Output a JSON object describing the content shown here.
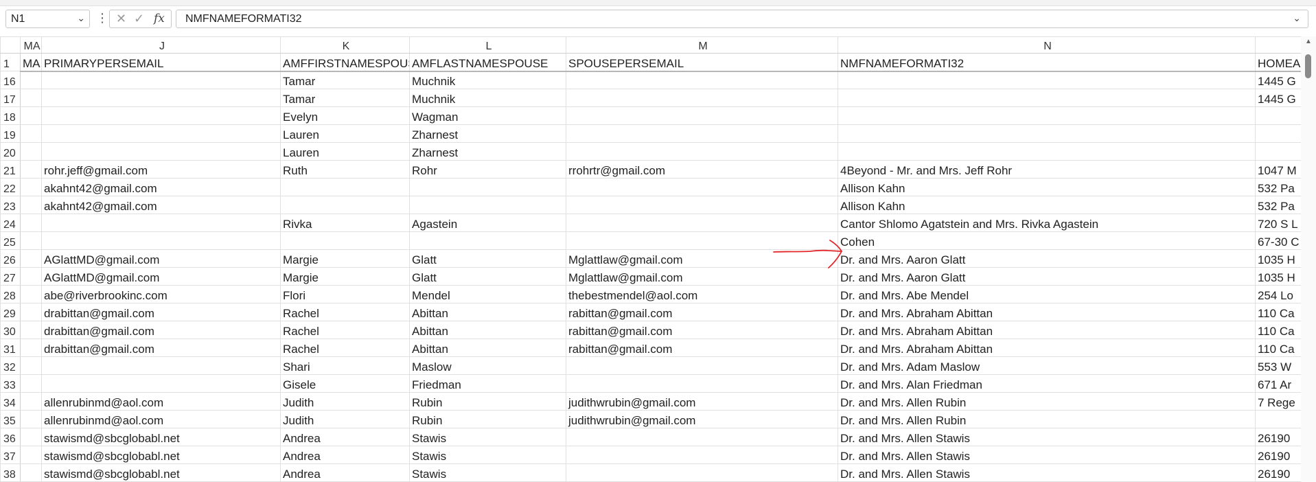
{
  "formula_bar": {
    "name_box": "N1",
    "formula": "NMFNAMEFORMATI32",
    "fx_label": "fx"
  },
  "columns": [
    "MA",
    "J",
    "K",
    "L",
    "M",
    "N",
    ""
  ],
  "header_row": {
    "row": "1",
    "cells": [
      "MA",
      "PRIMARYPERSEMAIL",
      "AMFFIRSTNAMESPOUSE",
      "AMFLASTNAMESPOUSE",
      "SPOUSEPERSEMAIL",
      "NMFNAMEFORMATI32",
      "HOMEADDRESS"
    ]
  },
  "rows": [
    {
      "row": "16",
      "cells": [
        "",
        "",
        "Tamar",
        "Muchnik",
        "",
        "",
        "1445 G"
      ]
    },
    {
      "row": "17",
      "cells": [
        "",
        "",
        "Tamar",
        "Muchnik",
        "",
        "",
        "1445 G"
      ]
    },
    {
      "row": "18",
      "cells": [
        "",
        "",
        "Evelyn",
        "Wagman",
        "",
        "",
        ""
      ]
    },
    {
      "row": "19",
      "cells": [
        "",
        "",
        "Lauren",
        "Zharnest",
        "",
        "",
        ""
      ]
    },
    {
      "row": "20",
      "cells": [
        "",
        "",
        "Lauren",
        "Zharnest",
        "",
        "",
        ""
      ]
    },
    {
      "row": "21",
      "cells": [
        "",
        "rohr.jeff@gmail.com",
        "Ruth",
        "Rohr",
        "rrohrtr@gmail.com",
        "4Beyond - Mr. and Mrs. Jeff Rohr",
        "1047 M"
      ]
    },
    {
      "row": "22",
      "cells": [
        "",
        "akahnt42@gmail.com",
        "",
        "",
        "",
        "Allison Kahn",
        "532 Pa"
      ]
    },
    {
      "row": "23",
      "cells": [
        "",
        "akahnt42@gmail.com",
        "",
        "",
        "",
        "Allison Kahn",
        "532 Pa"
      ]
    },
    {
      "row": "24",
      "cells": [
        "",
        "",
        "Rivka",
        "Agastein",
        "",
        "Cantor Shlomo Agatstein and Mrs. Rivka Agastein",
        "720 S L"
      ]
    },
    {
      "row": "25",
      "cells": [
        "",
        "",
        "",
        "",
        "",
        "Cohen",
        "67-30 C"
      ]
    },
    {
      "row": "26",
      "cells": [
        "",
        "AGlattMD@gmail.com",
        "Margie",
        "Glatt",
        "Mglattlaw@gmail.com",
        "Dr. and Mrs. Aaron Glatt",
        "1035 H"
      ]
    },
    {
      "row": "27",
      "cells": [
        "",
        "AGlattMD@gmail.com",
        "Margie",
        "Glatt",
        "Mglattlaw@gmail.com",
        "Dr. and Mrs. Aaron Glatt",
        "1035 H"
      ]
    },
    {
      "row": "28",
      "cells": [
        "",
        "abe@riverbrookinc.com",
        "Flori",
        "Mendel",
        "thebestmendel@aol.com",
        "Dr. and Mrs. Abe Mendel",
        "254 Lo"
      ]
    },
    {
      "row": "29",
      "cells": [
        "",
        "drabittan@gmail.com",
        "Rachel",
        "Abittan",
        "rabittan@gmail.com",
        "Dr. and Mrs. Abraham Abittan",
        "110 Ca"
      ]
    },
    {
      "row": "30",
      "cells": [
        "",
        "drabittan@gmail.com",
        "Rachel",
        "Abittan",
        "rabittan@gmail.com",
        "Dr. and Mrs. Abraham Abittan",
        "110 Ca"
      ]
    },
    {
      "row": "31",
      "cells": [
        "",
        "drabittan@gmail.com",
        "Rachel",
        "Abittan",
        "rabittan@gmail.com",
        "Dr. and Mrs. Abraham Abittan",
        "110 Ca"
      ]
    },
    {
      "row": "32",
      "cells": [
        "",
        "",
        "Shari",
        "Maslow",
        "",
        "Dr. and Mrs. Adam Maslow",
        "553 W"
      ]
    },
    {
      "row": "33",
      "cells": [
        "",
        "",
        "Gisele",
        "Friedman",
        "",
        "Dr. and Mrs. Alan Friedman",
        "671 Ar"
      ]
    },
    {
      "row": "34",
      "cells": [
        "",
        "allenrubinmd@aol.com",
        "Judith",
        "Rubin",
        "judithwrubin@gmail.com",
        "Dr. and Mrs. Allen Rubin",
        "7 Rege"
      ]
    },
    {
      "row": "35",
      "cells": [
        "",
        "allenrubinmd@aol.com",
        "Judith",
        "Rubin",
        "judithwrubin@gmail.com",
        "Dr. and Mrs. Allen Rubin",
        ""
      ]
    },
    {
      "row": "36",
      "cells": [
        "",
        "stawismd@sbcglobabl.net",
        "Andrea",
        "Stawis",
        "",
        "Dr. and Mrs. Allen Stawis",
        "26190"
      ]
    },
    {
      "row": "37",
      "cells": [
        "",
        "stawismd@sbcglobabl.net",
        "Andrea",
        "Stawis",
        "",
        "Dr. and Mrs. Allen Stawis",
        "26190"
      ]
    },
    {
      "row": "38",
      "cells": [
        "",
        "stawismd@sbcglobabl.net",
        "Andrea",
        "Stawis",
        "",
        "Dr. and Mrs. Allen Stawis",
        "26190"
      ]
    }
  ],
  "annotation": {
    "color": "#e3262b"
  }
}
